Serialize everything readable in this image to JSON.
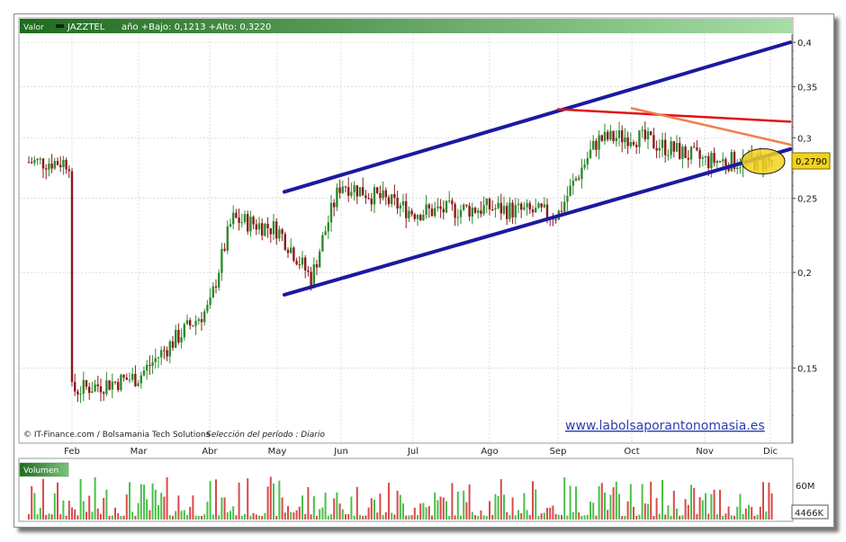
{
  "header": {
    "series_label": "Valor",
    "symbol": "JAZZTEL",
    "range_text": "año +Bajo: 0,1213 +Alto: 0,3220"
  },
  "source_note": "© IT-Finance.com / Bolsamania Tech Solutions",
  "period_note": "Selección del período : Diario",
  "watermark": "www.labolsaporantonomasia.es",
  "last_value_label": "0,2790",
  "volume": {
    "label": "Volumen",
    "tick_label": "60M",
    "last_label": "4466K"
  },
  "colors": {
    "header_green_dark": "#1f6b1f",
    "header_green_light": "#8fd08f",
    "up_bar": "#2e8b2e",
    "down_bar": "#8b1a1a",
    "channel": "#1a1aa0",
    "resistance_red": "#e01010",
    "resistance_orange": "#f08050",
    "highlight_fill": "#f2d21e"
  },
  "chart_data": [
    {
      "type": "candlestick",
      "title": "JAZZTEL",
      "y_scale": "log",
      "ylim": [
        0.128,
        0.41
      ],
      "y_ticks": [
        0.15,
        0.2,
        0.25,
        0.3,
        0.35,
        0.4
      ],
      "y_tick_labels": [
        "0,15",
        "0,2",
        "0,25",
        "0,3",
        "0,35",
        "0,4"
      ],
      "x_labels": [
        "Feb",
        "Mar",
        "Abr",
        "May",
        "Jun",
        "Jul",
        "Ago",
        "Sep",
        "Oct",
        "Nov",
        "Dic"
      ],
      "grid": true,
      "price_path": [
        [
          "Feb",
          0.14
        ],
        [
          "Mar",
          0.146
        ],
        [
          "Abr",
          0.18
        ],
        [
          "Abr-mid",
          0.235
        ],
        [
          "May",
          0.228
        ],
        [
          "May-mid",
          0.196
        ],
        [
          "Jun",
          0.262
        ],
        [
          "Jul",
          0.24
        ],
        [
          "Ago",
          0.243
        ],
        [
          "Sep",
          0.238
        ],
        [
          "Sep-mid",
          0.298
        ],
        [
          "Oct",
          0.302
        ],
        [
          "Nov",
          0.28
        ],
        [
          "Dic",
          0.279
        ]
      ],
      "annotations": [
        {
          "kind": "channel-upper",
          "from": [
            "May",
            0.255
          ],
          "to": [
            "Dic",
            0.4
          ]
        },
        {
          "kind": "channel-lower",
          "from": [
            "May",
            0.187
          ],
          "to": [
            "Dic",
            0.29
          ]
        },
        {
          "kind": "resistance",
          "color": "red",
          "from": [
            "Sep",
            0.327
          ],
          "to": [
            "Dic",
            0.315
          ]
        },
        {
          "kind": "resistance",
          "color": "orange",
          "from": [
            "Oct",
            0.328
          ],
          "to": [
            "Dic",
            0.294
          ]
        },
        {
          "kind": "highlight-ellipse",
          "at": [
            "Dic",
            0.278
          ]
        }
      ],
      "last_value": 0.279
    },
    {
      "type": "bar",
      "title": "Volumen",
      "y_ticks_label": [
        "60M"
      ],
      "last_value": "4466K"
    }
  ]
}
